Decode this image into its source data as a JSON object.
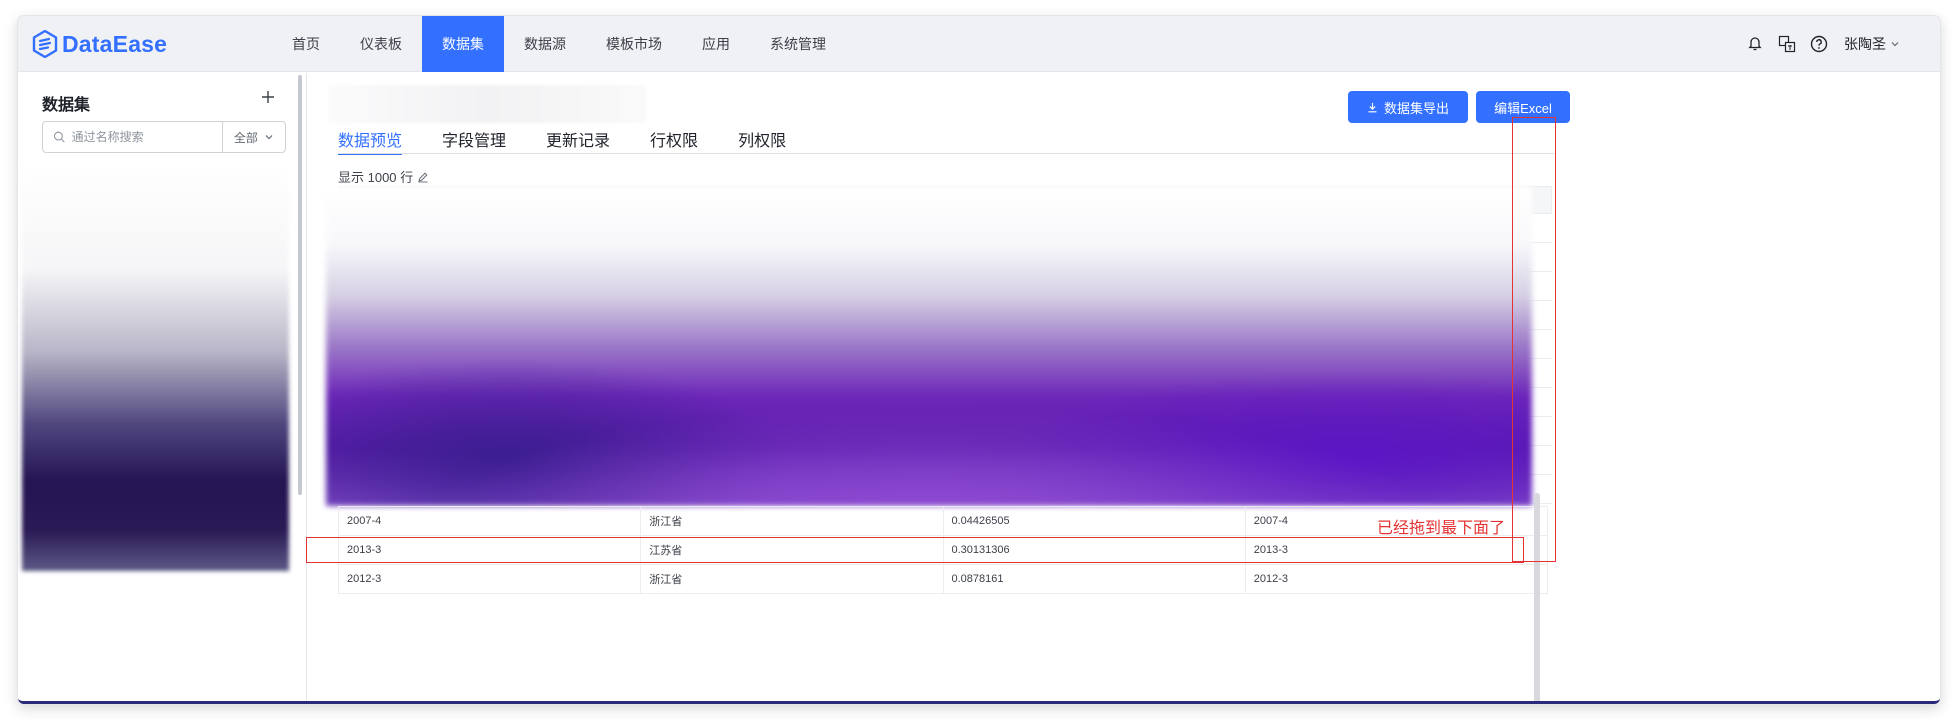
{
  "app": {
    "brand": "DataEase",
    "accent_color": "#3370ff",
    "annotation_color": "#e53333"
  },
  "nav": {
    "items": [
      {
        "label": "首页"
      },
      {
        "label": "仪表板"
      },
      {
        "label": "数据集",
        "active": true
      },
      {
        "label": "数据源"
      },
      {
        "label": "模板市场"
      },
      {
        "label": "应用"
      },
      {
        "label": "系统管理"
      }
    ],
    "icons": [
      "notification-icon",
      "translate-icon",
      "help-icon"
    ],
    "user_name": "张陶圣"
  },
  "sidebar": {
    "title": "数据集",
    "search_placeholder": "通过名称搜索",
    "filter_label": "全部"
  },
  "main": {
    "export_button": "数据集导出",
    "edit_button": "编辑Excel",
    "tabs": [
      {
        "label": "数据预览",
        "active": true
      },
      {
        "label": "字段管理"
      },
      {
        "label": "更新记录"
      },
      {
        "label": "行权限"
      },
      {
        "label": "列权限"
      }
    ],
    "row_info": "显示 1000 行",
    "rows": [
      [
        "2007-4",
        "浙江省",
        "0.04426505",
        "2007-4"
      ],
      [
        "2013-3",
        "江苏省",
        "0.30131306",
        "2013-3"
      ],
      [
        "2012-3",
        "浙江省",
        "0.0878161",
        "2012-3"
      ]
    ]
  },
  "annotation": {
    "text": "已经拖到最下面了"
  }
}
